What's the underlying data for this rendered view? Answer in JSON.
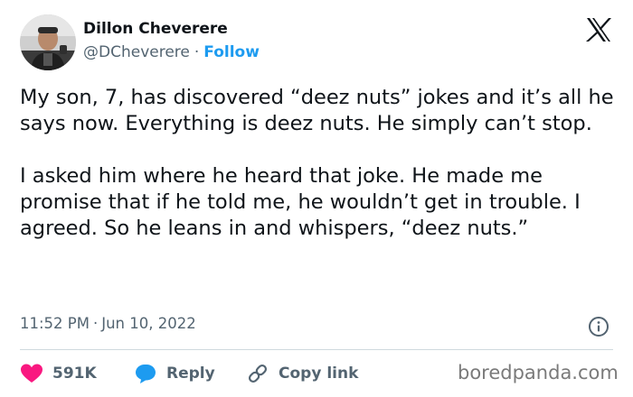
{
  "author": {
    "name": "Dillon Cheverere",
    "handle": "@DCheverere",
    "separator": "·",
    "follow_label": "Follow"
  },
  "platform_logo": "x-logo-icon",
  "tweet": {
    "paragraphs": [
      "My son, 7, has discovered “deez nuts” jokes and it’s all he says now. Everything is deez nuts. He simply can’t stop.",
      "I asked him where he heard that joke. He made me promise that if he told me, he wouldn’t get in trouble. I agreed. So he leans in and whispers, “deez nuts.”"
    ]
  },
  "meta": {
    "time": "11:52 PM",
    "separator": "·",
    "date": "Jun 10, 2022",
    "info_icon": "info-icon"
  },
  "actions": {
    "like_count": "591K",
    "reply_label": "Reply",
    "copy_link_label": "Copy link",
    "like_icon": "heart-icon",
    "reply_icon": "chat-bubble-icon",
    "copy_icon": "link-icon"
  },
  "watermark": "boredpanda.com",
  "colors": {
    "text": "#0f1419",
    "secondary": "#536471",
    "link": "#1d9bf0",
    "heart": "#f91880",
    "divider": "#cfd9de"
  }
}
